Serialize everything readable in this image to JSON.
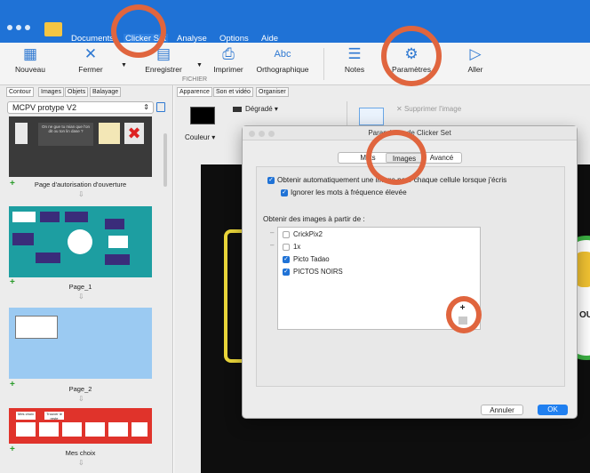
{
  "menubar": {
    "items": [
      "Documents",
      "Clicker Set",
      "Analyse",
      "Options",
      "Aide"
    ],
    "active": "Clicker Set"
  },
  "ribbon": {
    "buttons": [
      {
        "label": "Nouveau",
        "icon": "new-grid-icon"
      },
      {
        "label": "Fermer",
        "icon": "close-x-icon"
      },
      {
        "label": "Enregistrer",
        "icon": "save-icon"
      },
      {
        "label": "Imprimer",
        "icon": "printer-icon"
      },
      {
        "label": "Orthographique",
        "icon": "spellcheck-icon"
      },
      {
        "label": "Notes",
        "icon": "notes-icon"
      },
      {
        "label": "Paramètres",
        "icon": "gear-icon"
      },
      {
        "label": "Aller",
        "icon": "play-arrow-icon"
      }
    ],
    "group_label": "FICHIER"
  },
  "left_panel": {
    "tabs": [
      "Contour",
      "Images",
      "Objets",
      "Balayage"
    ],
    "selected_set": "MCPV protype V2",
    "pages": [
      {
        "label": "Page d'autorisation d'ouverture",
        "thumb_text": "On ne gue tu mian que l'on dit ou ton lin dase ?"
      },
      {
        "label": "Page_1"
      },
      {
        "label": "Page_2"
      },
      {
        "label": "Mes choix",
        "thumb_text": [
          "Mes choix",
          "Trouver le reste"
        ]
      }
    ]
  },
  "right_panel": {
    "tabs": [
      "Apparence",
      "Son et vidéo",
      "Organiser"
    ],
    "gradient_label": "Dégradé",
    "color_label": "Couleur",
    "remove_image": "Supprimer l'image",
    "stage_text": "OU"
  },
  "dialog": {
    "title": "Paramètres de Clicker Set",
    "tabs": [
      "Mots",
      "Images",
      "Avancé"
    ],
    "selected_tab": "Images",
    "option_auto": "Obtenir automatiquement une image pour chaque cellule lorsque j'écris",
    "option_ignore": "Ignorer les mots à fréquence élevée",
    "source_label": "Obtenir des images à partir de :",
    "sources": [
      {
        "name": "CrickPix2",
        "checked": false
      },
      {
        "name": "1x",
        "checked": false
      },
      {
        "name": "Picto Tadao",
        "checked": true
      },
      {
        "name": "PICTOS NOIRS",
        "checked": true
      }
    ],
    "cancel": "Annuler",
    "ok": "OK"
  },
  "colors": {
    "accent": "#1f72d6",
    "highlight_ring": "#e0653e"
  }
}
